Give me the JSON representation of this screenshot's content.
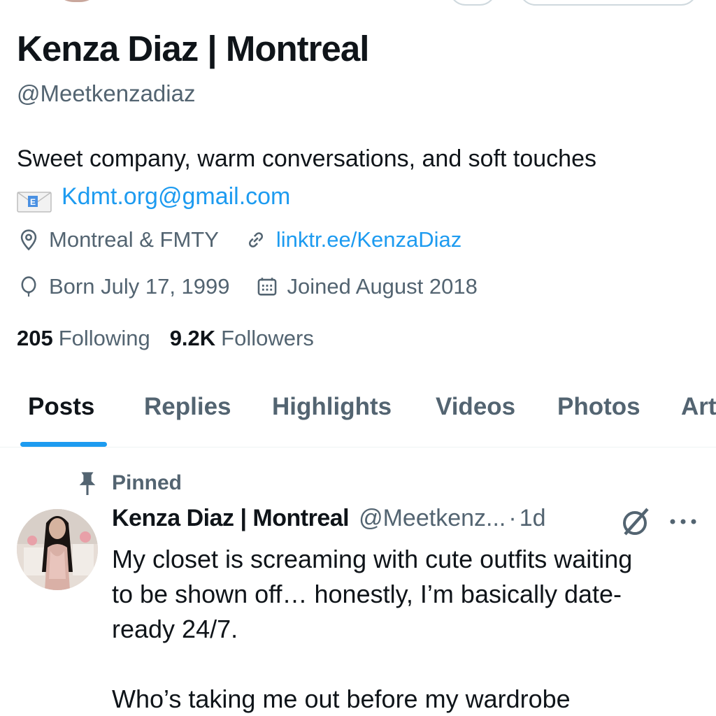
{
  "profile": {
    "name": "Kenza Diaz | Montreal",
    "handle": "@Meetkenzadiaz",
    "bio_line1": "Sweet company, warm conversations, and soft touches",
    "bio_email": "Kdmt.org@gmail.com",
    "location": "Montreal & FMTY",
    "website": "linktr.ee/KenzaDiaz",
    "birthday": "Born July 17, 1999",
    "joined": "Joined August 2018",
    "following_count": "205",
    "following_label": "Following",
    "followers_count": "9.2K",
    "followers_label": "Followers"
  },
  "tabs": [
    "Posts",
    "Replies",
    "Highlights",
    "Videos",
    "Photos",
    "Art"
  ],
  "active_tab": "Posts",
  "pinned_post": {
    "pinned_label": "Pinned",
    "author_name": "Kenza Diaz | Montreal",
    "author_handle": "@Meetkenz...",
    "separator": "·",
    "time": "1d",
    "text": "My closet is screaming with cute outfits waiting\nto be shown off… honestly, I’m basically date-\nready 24/7.\n\nWho’s taking me out before my wardrobe"
  },
  "icons": {
    "location": "location-pin-icon",
    "website": "link-icon",
    "birthday": "balloon-icon",
    "joined": "calendar-icon",
    "pinned": "pin-icon",
    "grok": "grok-icon",
    "more": "more-icon",
    "envelope": "envelope-emoji-icon"
  },
  "colors": {
    "accent": "#1d9bf0",
    "text_primary": "#0f1419",
    "text_secondary": "#536471",
    "divider": "#eff3f4"
  }
}
